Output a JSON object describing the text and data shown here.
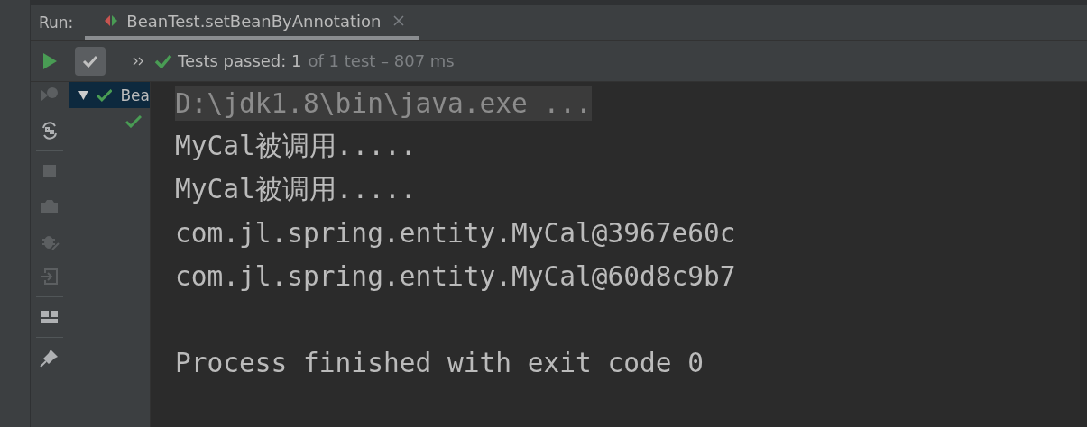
{
  "run_label": "Run:",
  "tab": {
    "title": "BeanTest.setBeanByAnnotation",
    "selected": true
  },
  "toolbar": {
    "run_enabled": true,
    "show_passed": {
      "checked": true
    },
    "summary": {
      "count_text": "Tests passed: 1",
      "detail_text": "of 1 test – 807 ms"
    }
  },
  "side_tools": [
    {
      "kind": "rerun-failed",
      "disabled": true
    },
    {
      "kind": "auto-test",
      "disabled": false
    },
    {
      "kind": "separator"
    },
    {
      "kind": "stop",
      "disabled": true
    },
    {
      "kind": "camera",
      "disabled": true
    },
    {
      "kind": "export",
      "disabled": true
    },
    {
      "kind": "import",
      "disabled": true
    },
    {
      "kind": "separator"
    },
    {
      "kind": "layout",
      "disabled": false
    },
    {
      "kind": "separator"
    },
    {
      "kind": "pin",
      "disabled": false
    }
  ],
  "tree": [
    {
      "label": "Bea",
      "passed": true,
      "expanded": true,
      "selected": true,
      "children": [
        {
          "passed": true,
          "selected": false
        }
      ]
    }
  ],
  "console": [
    {
      "kind": "command",
      "text": "D:\\jdk1.8\\bin\\java.exe ..."
    },
    {
      "kind": "output",
      "text": "MyCal被调用....."
    },
    {
      "kind": "output",
      "text": "MyCal被调用....."
    },
    {
      "kind": "output",
      "text": "com.jl.spring.entity.MyCal@3967e60c"
    },
    {
      "kind": "output",
      "text": "com.jl.spring.entity.MyCal@60d8c9b7"
    },
    {
      "kind": "blank"
    },
    {
      "kind": "output",
      "text": "Process finished with exit code 0"
    }
  ]
}
